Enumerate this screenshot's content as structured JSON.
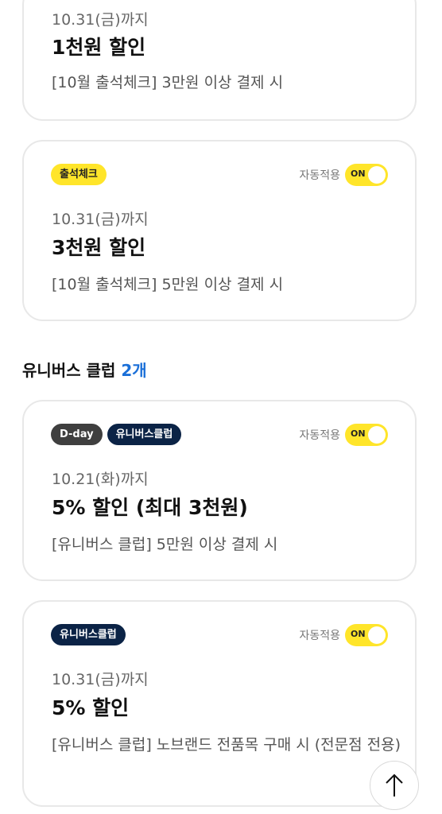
{
  "coupons_top": [
    {
      "date": "10.31(금)까지",
      "amount": "1천원 할인",
      "condition": "[10월 출석체크] 3만원 이상 결제 시"
    },
    {
      "badges": [
        "출석체크"
      ],
      "auto_label": "자동적용",
      "toggle": "ON",
      "date": "10.31(금)까지",
      "amount": "3천원 할인",
      "condition": "[10월 출석체크] 5만원 이상 결제 시"
    }
  ],
  "section": {
    "title": "유니버스 클럽",
    "count": "2개"
  },
  "coupons_universe": [
    {
      "badges": [
        "D-day",
        "유니버스클럽"
      ],
      "auto_label": "자동적용",
      "toggle": "ON",
      "date": "10.21(화)까지",
      "amount": "5% 할인 (최대 3천원)",
      "condition": "[유니버스 클럽] 5만원 이상 결제 시"
    },
    {
      "badges": [
        "유니버스클럽"
      ],
      "auto_label": "자동적용",
      "toggle": "ON",
      "date": "10.31(금)까지",
      "amount": "5% 할인",
      "condition": "[유니버스 클럽] 노브랜드 전품목 구매 시 (전문점 전용)"
    }
  ],
  "icons": {
    "scroll_top": "arrow-up-icon"
  },
  "colors": {
    "accent_yellow": "#ffe52a",
    "navy_badge": "#0b2346",
    "count_blue": "#1a6fd8"
  }
}
